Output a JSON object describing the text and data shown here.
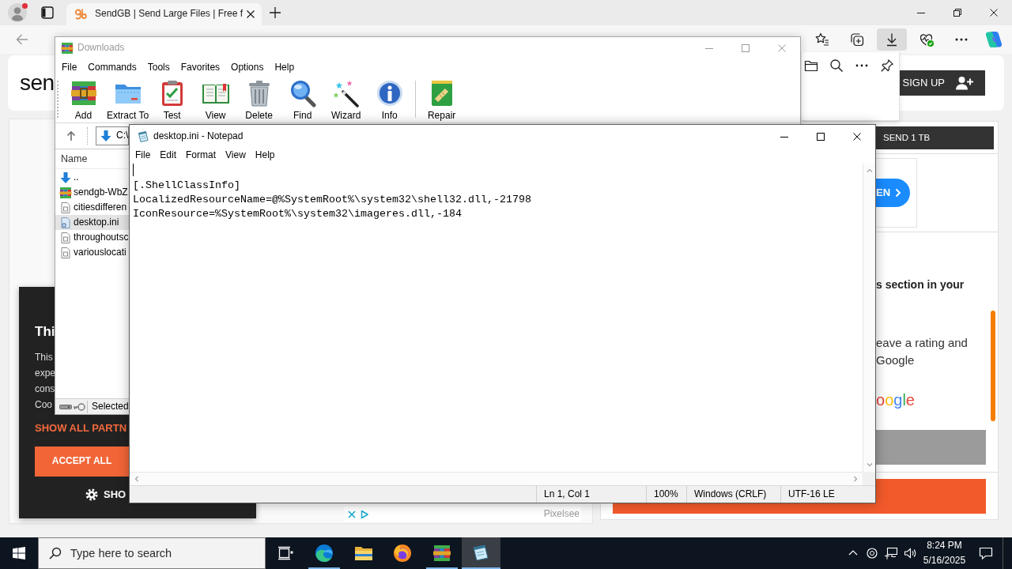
{
  "browser": {
    "tabs": [
      {
        "title": "SendGB | Send Large Files | Free f",
        "selected": true
      }
    ],
    "downloads_button": {
      "pressed": true
    },
    "page": {
      "logo": "sen",
      "sign_up_button": "SIGN UP",
      "send_bar": "SEND 1 TB",
      "open_button": "EN",
      "review": {
        "heading": "s section in your",
        "lines": [
          "eave a rating and",
          "Google"
        ],
        "google_logo": "oogle"
      },
      "cookie_banner": {
        "heading": "Thi",
        "lines": [
          "This",
          "expe",
          "cons",
          "Coo"
        ],
        "partners_link": "SHOW ALL PARTN",
        "accept_button": "ACCEPT ALL",
        "settings_button": "SHO"
      },
      "ad": {
        "brand": "Pixelsee"
      }
    }
  },
  "winrar": {
    "title": "Downloads",
    "active": false,
    "menu": [
      "File",
      "Commands",
      "Tools",
      "Favorites",
      "Options",
      "Help"
    ],
    "toolbar": [
      {
        "label": "Add",
        "kind": "add",
        "separator_before": false
      },
      {
        "label": "Extract To",
        "kind": "extract",
        "separator_before": false
      },
      {
        "label": "Test",
        "kind": "test",
        "separator_before": false
      },
      {
        "label": "View",
        "kind": "view",
        "separator_before": false
      },
      {
        "label": "Delete",
        "kind": "delete",
        "separator_before": false
      },
      {
        "label": "Find",
        "kind": "find",
        "separator_before": false
      },
      {
        "label": "Wizard",
        "kind": "wizard",
        "separator_before": false
      },
      {
        "label": "Info",
        "kind": "info",
        "separator_before": false
      },
      {
        "label": "Repair",
        "kind": "repair",
        "separator_before": true
      }
    ],
    "path": "C:\\",
    "column": "Name",
    "files": [
      {
        "name": "..",
        "kind": "parent",
        "selected": false
      },
      {
        "name": "sendgb-WbZ",
        "kind": "archive",
        "selected": false
      },
      {
        "name": "citiesdifferen",
        "kind": "document",
        "selected": false
      },
      {
        "name": "desktop.ini",
        "kind": "settings",
        "selected": true
      },
      {
        "name": "throughoutsc",
        "kind": "document",
        "selected": false
      },
      {
        "name": "variouslocati",
        "kind": "document",
        "selected": false
      }
    ],
    "status": "Selected"
  },
  "notepad": {
    "title": "desktop.ini - Notepad",
    "active": true,
    "menu": [
      "File",
      "Edit",
      "Format",
      "View",
      "Help"
    ],
    "text": "\n[.ShellClassInfo]\nLocalizedResourceName=@%SystemRoot%\\system32\\shell32.dll,-21798\nIconResource=%SystemRoot%\\system32\\imageres.dll,-184",
    "status": [
      "Ln 1, Col 1",
      "100%",
      "Windows (CRLF)",
      "UTF-16 LE"
    ]
  },
  "taskbar": {
    "search": {
      "placeholder": "Type here to search"
    },
    "apps": [
      {
        "kind": "task_view",
        "running": false,
        "selected": false
      },
      {
        "kind": "edge",
        "running": true,
        "selected": false
      },
      {
        "kind": "explorer",
        "running": false,
        "selected": false
      },
      {
        "kind": "firefox",
        "running": false,
        "selected": false
      },
      {
        "kind": "winrar",
        "running": true,
        "selected": false
      },
      {
        "kind": "notepad",
        "running": true,
        "selected": true
      }
    ],
    "time": "8:24 PM",
    "date": "5/16/2025"
  }
}
